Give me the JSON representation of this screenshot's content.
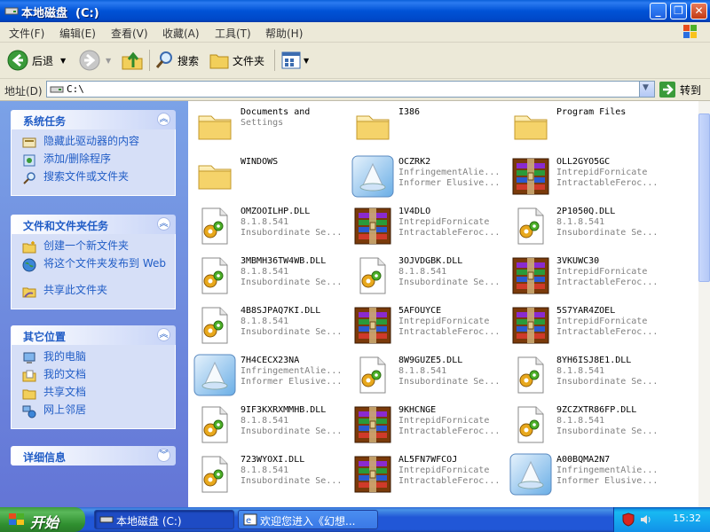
{
  "window": {
    "title": "本地磁盘  (C:)"
  },
  "menu": [
    "文件(F)",
    "编辑(E)",
    "查看(V)",
    "收藏(A)",
    "工具(T)",
    "帮助(H)"
  ],
  "toolbar": {
    "back": "后退",
    "search": "搜索",
    "folders": "文件夹"
  },
  "address": {
    "label": "地址(D)",
    "value": "C:\\",
    "go": "转到"
  },
  "taskpane": {
    "system_tasks": {
      "title": "系统任务",
      "items": [
        "隐藏此驱动器的内容",
        "添加/删除程序",
        "搜索文件或文件夹"
      ]
    },
    "file_tasks": {
      "title": "文件和文件夹任务",
      "items": [
        "创建一个新文件夹",
        "将这个文件夹发布到 Web",
        "共享此文件夹"
      ]
    },
    "other_places": {
      "title": "其它位置",
      "items": [
        "我的电脑",
        "我的文档",
        "共享文档",
        "网上邻居"
      ]
    },
    "details": {
      "title": "详细信息"
    }
  },
  "files": [
    {
      "icon": "folder",
      "l1": "Documents and",
      "l2": "Settings",
      "l3": ""
    },
    {
      "icon": "folder",
      "l1": "I386",
      "l2": "",
      "l3": ""
    },
    {
      "icon": "folder",
      "l1": "Program Files",
      "l2": "",
      "l3": ""
    },
    {
      "icon": "folder",
      "l1": "WINDOWS",
      "l2": "",
      "l3": ""
    },
    {
      "icon": "installer",
      "l1": "OCZRK2",
      "l2": "InfringementAlie...",
      "l3": "Informer Elusive..."
    },
    {
      "icon": "archive",
      "l1": "OLL2GYO5GC",
      "l2": "IntrepidFornicate",
      "l3": "IntractableFeroc..."
    },
    {
      "icon": "dll",
      "l1": "OMZOOILHP.DLL",
      "l2": "8.1.8.541",
      "l3": "Insubordinate Se..."
    },
    {
      "icon": "archive",
      "l1": "1V4DLO",
      "l2": "IntrepidFornicate",
      "l3": "IntractableFeroc..."
    },
    {
      "icon": "dll",
      "l1": "2P1050Q.DLL",
      "l2": "8.1.8.541",
      "l3": "Insubordinate Se..."
    },
    {
      "icon": "dll",
      "l1": "3MBMH36TW4WB.DLL",
      "l2": "8.1.8.541",
      "l3": "Insubordinate Se..."
    },
    {
      "icon": "dll",
      "l1": "3OJVDGBK.DLL",
      "l2": "8.1.8.541",
      "l3": "Insubordinate Se..."
    },
    {
      "icon": "archive",
      "l1": "3VKUWC30",
      "l2": "IntrepidFornicate",
      "l3": "IntractableFeroc..."
    },
    {
      "icon": "dll",
      "l1": "4B8SJPAQ7KI.DLL",
      "l2": "8.1.8.541",
      "l3": "Insubordinate Se..."
    },
    {
      "icon": "archive",
      "l1": "5AFOUYCE",
      "l2": "IntrepidFornicate",
      "l3": "IntractableFeroc..."
    },
    {
      "icon": "archive",
      "l1": "5S7YAR4ZOEL",
      "l2": "IntrepidFornicate",
      "l3": "IntractableFeroc..."
    },
    {
      "icon": "installer",
      "l1": "7H4CECX23NA",
      "l2": "InfringementAlie...",
      "l3": "Informer Elusive..."
    },
    {
      "icon": "dll",
      "l1": "8W9GUZE5.DLL",
      "l2": "8.1.8.541",
      "l3": "Insubordinate Se..."
    },
    {
      "icon": "dll",
      "l1": "8YH6ISJ8E1.DLL",
      "l2": "8.1.8.541",
      "l3": "Insubordinate Se..."
    },
    {
      "icon": "dll",
      "l1": "9IF3KXRXMMHB.DLL",
      "l2": "8.1.8.541",
      "l3": "Insubordinate Se..."
    },
    {
      "icon": "archive",
      "l1": "9KHCNGE",
      "l2": "IntrepidFornicate",
      "l3": "IntractableFeroc..."
    },
    {
      "icon": "dll",
      "l1": "9ZCZXTR86FP.DLL",
      "l2": "8.1.8.541",
      "l3": "Insubordinate Se..."
    },
    {
      "icon": "dll",
      "l1": "723WYOXI.DLL",
      "l2": "8.1.8.541",
      "l3": "Insubordinate Se..."
    },
    {
      "icon": "archive",
      "l1": "AL5FN7WFCOJ",
      "l2": "IntrepidFornicate",
      "l3": "IntractableFeroc..."
    },
    {
      "icon": "installer",
      "l1": "A00BQMA2N7",
      "l2": "InfringementAlie...",
      "l3": "Informer Elusive..."
    }
  ],
  "taskbar": {
    "start": "开始",
    "tasks": [
      "本地磁盘 (C:)",
      "欢迎您进入《幻想..."
    ],
    "clock": "15:32"
  },
  "colors": {
    "titlebar": "#0052d6",
    "taskpane_link": "#215dc6",
    "start_green": "#3c9a3c"
  }
}
